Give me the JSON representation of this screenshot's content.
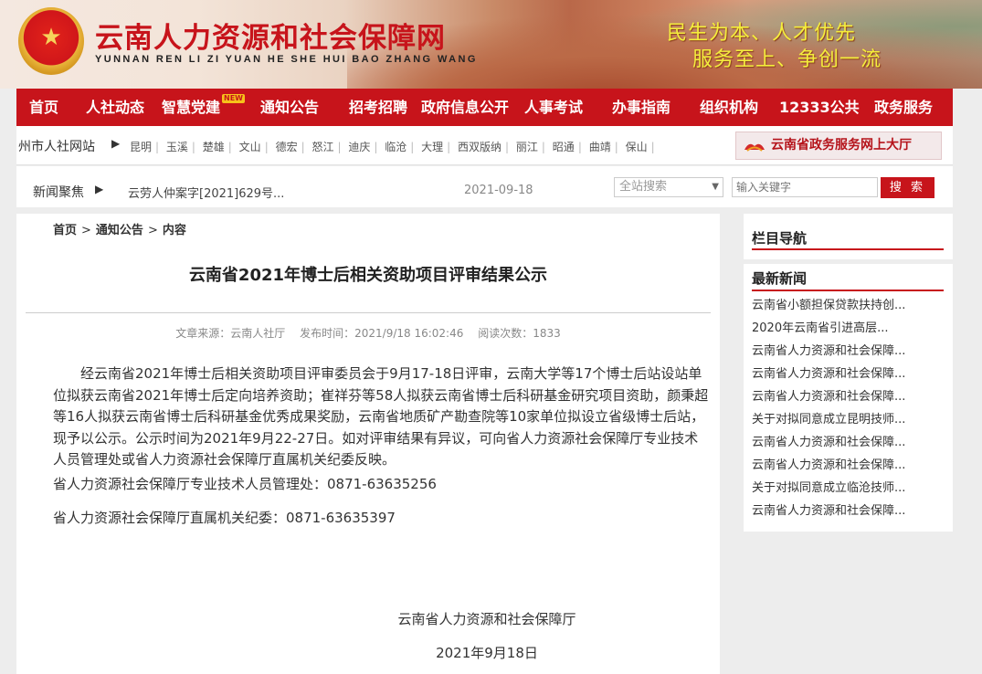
{
  "header": {
    "site_title": "云南人力资源和社会保障网",
    "site_pinyin": "YUNNAN REN LI ZI YUAN HE SHE HUI BAO ZHANG WANG",
    "slogan_line1": "民生为本、人才优先",
    "slogan_line2": "服务至上、争创一流",
    "emblem_icon": "national-emblem-icon"
  },
  "nav": {
    "items": [
      {
        "label": "首页"
      },
      {
        "label": "人社动态"
      },
      {
        "label": "智慧党建",
        "badge": "NEW"
      },
      {
        "label": "通知公告"
      },
      {
        "label": "招考招聘"
      },
      {
        "label": "政府信息公开"
      },
      {
        "label": "人事考试"
      },
      {
        "label": "办事指南"
      },
      {
        "label": "组织机构"
      },
      {
        "label": "12333公共"
      },
      {
        "label": "政务服务"
      }
    ]
  },
  "citybar": {
    "label": "州市人社网站",
    "arrow_icon": "triangle-right-icon",
    "cities": [
      "昆明",
      "玉溪",
      "楚雄",
      "文山",
      "德宏",
      "怒江",
      "迪庆",
      "临沧",
      "大理",
      "西双版纳",
      "丽江",
      "昭通",
      "曲靖",
      "保山"
    ],
    "gov_service_label": "云南省政务服务网上大厅"
  },
  "focus": {
    "label": "新闻聚焦",
    "news": "云劳人仲案字[2021]629号...",
    "date": "2021-09-18",
    "search_scope": "全站搜索",
    "search_placeholder": "输入关键字",
    "search_button": "搜 索"
  },
  "article": {
    "breadcrumb": [
      "首页",
      "通知公告",
      "内容"
    ],
    "title": "云南省2021年博士后相关资助项目评审结果公示",
    "source": "文章来源：云南人社厅",
    "published": "发布时间：2021/9/18 16:02:46",
    "views": "阅读次数：1833",
    "body": "经云南省2021年博士后相关资助项目评审委员会于9月17-18日评审，云南大学等17个博士后站设站单位拟获云南省2021年博士后定向培养资助；崔祥芬等58人拟获云南省博士后科研基金研究项目资助，颜秉超等16人拟获云南省博士后科研基金优秀成果奖励，云南省地质矿产勘查院等10家单位拟设立省级博士后站，现予以公示。公示时间为2021年9月22-27日。如对评审结果有异议，可向省人力资源社会保障厅专业技术人员管理处或省人力资源社会保障厅直属机关纪委反映。",
    "contact1": "省人力资源社会保障厅专业技术人员管理处：0871-63635256",
    "contact2": "省人力资源社会保障厅直属机关纪委：0871-63635397",
    "sign_org": "云南省人力资源和社会保障厅",
    "sign_date": "2021年9月18日"
  },
  "sidebar": {
    "nav_heading": "栏目导航",
    "latest_heading": "最新新闻",
    "latest": [
      "云南省小额担保贷款扶持创...",
      "2020年云南省引进高层...",
      "云南省人力资源和社会保障...",
      "云南省人力资源和社会保障...",
      "云南省人力资源和社会保障...",
      "关于对拟同意成立昆明技师...",
      "云南省人力资源和社会保障...",
      "云南省人力资源和社会保障...",
      "关于对拟同意成立临沧技师...",
      "云南省人力资源和社会保障..."
    ]
  },
  "colors": {
    "brand_red": "#c7141b",
    "slogan_yellow": "#f4ee3c"
  }
}
